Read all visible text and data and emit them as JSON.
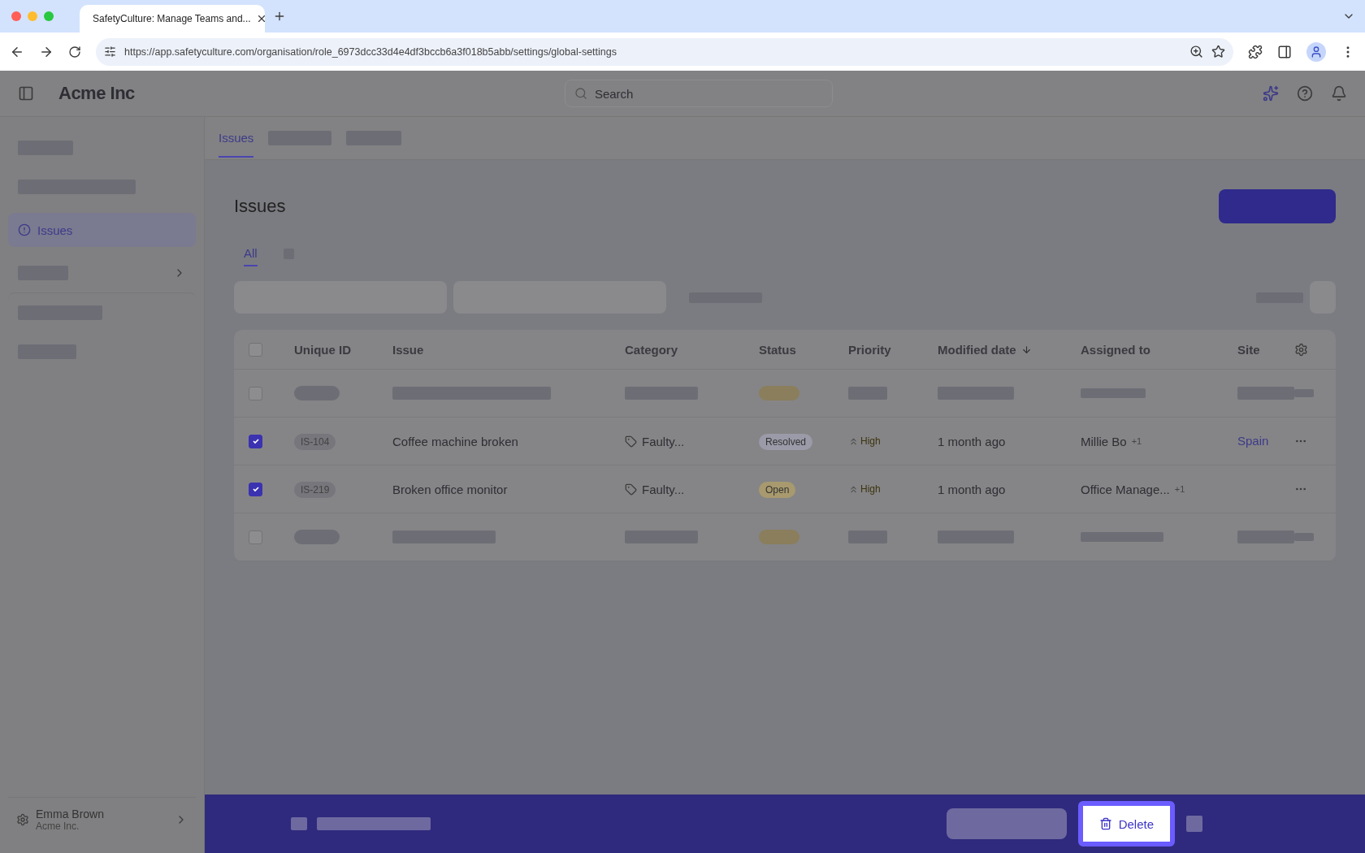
{
  "browser": {
    "tab_title": "SafetyCulture: Manage Teams and...",
    "url": "https://app.safetyculture.com/organisation/role_6973dcc33d4e4df3bccb6a3f018b5abb/settings/global-settings"
  },
  "header": {
    "logo": "Acme Inc",
    "search": {
      "placeholder": "Search"
    }
  },
  "sidebar": {
    "items": [
      {
        "kind": "skeleton"
      },
      {
        "kind": "skeleton"
      },
      {
        "kind": "link",
        "label": "Issues",
        "selected": true
      },
      {
        "kind": "expandable"
      },
      {
        "kind": "skeleton"
      },
      {
        "kind": "skeleton"
      }
    ],
    "user": {
      "name": "Emma Brown",
      "org": "Acme Inc."
    }
  },
  "tabs": [
    {
      "label": "Issues",
      "selected": true
    },
    {
      "selected": false
    },
    {
      "selected": false
    }
  ],
  "page": {
    "title": "Issues",
    "subtabs": [
      {
        "label": "All",
        "selected": true
      },
      {
        "selected": false
      }
    ]
  },
  "table": {
    "columns": [
      "Unique ID",
      "Issue",
      "Category",
      "Status",
      "Priority",
      "Modified date",
      "Assigned to",
      "Site"
    ],
    "select_all_checked": false,
    "rows": [
      {
        "kind": "skeleton",
        "checked": false
      },
      {
        "kind": "issue",
        "checked": true,
        "id": "IS-104",
        "issue": "Coffee machine broken",
        "category": "Faulty...",
        "status": "Resolved",
        "color": "#9a9aa8",
        "priority": "High",
        "modified": "1 month ago",
        "assigned": "Millie Bo",
        "assigned_extra": "+1",
        "site": "Spain"
      },
      {
        "kind": "issue",
        "checked": true,
        "id": "IS-219",
        "issue": "Broken office monitor",
        "category": "Faulty...",
        "status": "Open",
        "color": "#a89a6e",
        "priority": "High",
        "modified": "1 month ago",
        "assigned": "Office Manage...",
        "assigned_extra": "+1"
      },
      {
        "kind": "skeleton",
        "checked": false
      }
    ]
  },
  "action_bar": {
    "select_checked": false,
    "delete": "Delete"
  }
}
